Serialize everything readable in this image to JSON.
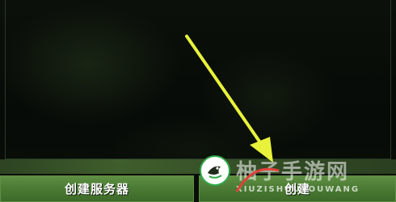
{
  "buttons": {
    "create_server_label": "创建服务器",
    "right_label": "创建"
  },
  "watermark": {
    "title": "柚子手游网",
    "subtitle": "XIUZISHOUYOUWANG"
  },
  "colors": {
    "button_green": "#4a7a33",
    "arrow_yellow": "#e8f23a",
    "watermark_green": "#2fa84a",
    "watermark_red": "#e0413a"
  },
  "icons": {
    "annotation": "arrow-pointing-down-right",
    "watermark_logo": "bird-in-circle-icon"
  }
}
